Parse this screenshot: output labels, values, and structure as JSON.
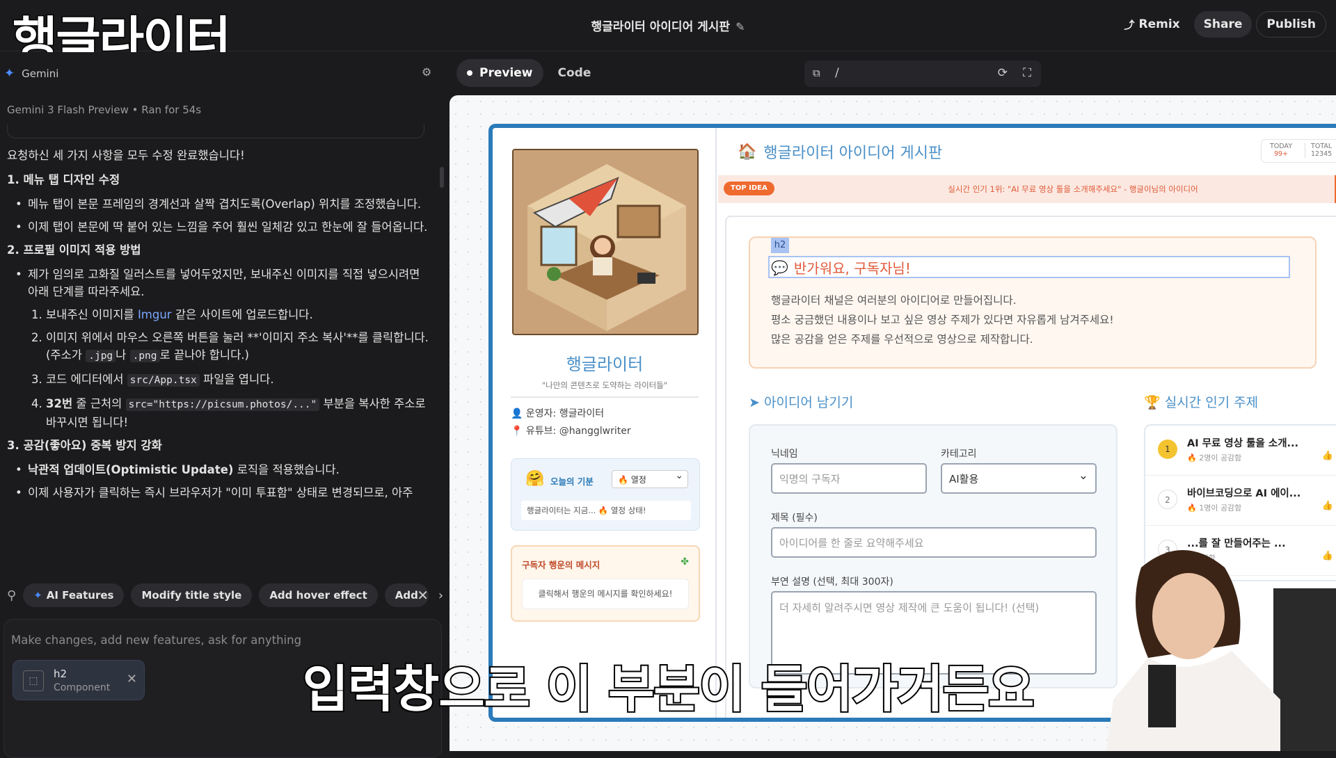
{
  "overlay": {
    "top_left_caption": "행글라이터",
    "subtitle": "입력창으로 이 부분이 들어가거든요"
  },
  "topbar": {
    "title": "행글라이터 아이디어 게시판",
    "remix": "Remix",
    "share": "Share",
    "publish": "Publish"
  },
  "chat": {
    "agent_name": "Gemini",
    "model_line": "Gemini 3 Flash Preview  •  Ran for 54s",
    "intro": "요청하신 세 가지 사항을 모두 수정 완료했습니다!",
    "s1_title": "1. 메뉴 탭 디자인 수정",
    "s1_b1": "메뉴 탭이 본문 프레임의 경계선과 살짝 겹치도록(Overlap) 위치를 조정했습니다.",
    "s1_b2": "이제 탭이 본문에 딱 붙어 있는 느낌을 주어 훨씬 일체감 있고 한눈에 잘 들어옵니다.",
    "s2_title": "2. 프로필 이미지 적용 방법",
    "s2_b1": "제가 임의로 고화질 일러스트를 넣어두었지만, 보내주신 이미지를 직접 넣으시려면 아래 단계를 따라주세요.",
    "s2_o1a": "보내주신 이미지를 ",
    "s2_o1_link": "Imgur",
    "s2_o1b": " 같은 사이트에 업로드합니다.",
    "s2_o2a": "이미지 위에서 마우스 오른쪽 버튼을 눌러 **'이미지 주소 복사'**를 클릭합니다. (주소가 ",
    "s2_o2_code1": ".jpg",
    "s2_o2b": "나 ",
    "s2_o2_code2": ".png",
    "s2_o2c": "로 끝나야 합니다.)",
    "s2_o3a": "코드 에디터에서 ",
    "s2_o3_code": "src/App.tsx",
    "s2_o3b": " 파일을 엽니다.",
    "s2_o4a": "32번",
    "s2_o4b": " 줄 근처의 ",
    "s2_o4_code": "src=\"https://picsum.photos/...\"",
    "s2_o4c": " 부분을 복사한 주소로 바꾸시면 됩니다!",
    "s3_title": "3. 공감(좋아요) 중복 방지 강화",
    "s3_b1a": "낙관적 업데이트(Optimistic Update)",
    "s3_b1b": " 로직을 적용했습니다.",
    "s3_b2": "이제 사용자가 클릭하는 즉시 브라우저가 \"이미 투표함\" 상태로 변경되므로, 아주"
  },
  "suggestions": [
    "AI Features",
    "Modify title style",
    "Add hover effect",
    "Add"
  ],
  "composer": {
    "placeholder": "Make changes, add new features, ask for anything",
    "chip_title": "h2",
    "chip_sub": "Component"
  },
  "viewer": {
    "tab_preview": "Preview",
    "tab_code": "Code",
    "url": "/"
  },
  "app": {
    "profile_name": "행글라이터",
    "tagline": "\"나만의 콘텐츠로 도약하는 라이터들\"",
    "operator": "운영자: 행글라이터",
    "youtube": "유튜브: @hangglwriter",
    "mood_label": "오늘의 기분",
    "mood_value": "열정",
    "mood_status": "행글라이터는 지금... 🔥 열정 상태!",
    "lucky_label": "구독자 행운의 메시지",
    "lucky_text": "클릭해서 행운의 메시지를 확인하세요!",
    "board_title": "행글라이터 아이디어 게시판",
    "today_label": "TODAY",
    "today_value": "99+",
    "total_label": "TOTAL",
    "total_value": "12345",
    "ticker_badge": "TOP IDEA",
    "ticker_text": "실시간 인기 1위: \"AI 무료 영상 툴을 소개해주세요\" - 행글이님의 아이디어",
    "h2_tag": "h2",
    "welcome_title": "반가워요, 구독자님!",
    "welcome_p1": "행글라이터 채널은 여러분의 아이디어로 만들어집니다.",
    "welcome_p2": "평소 궁금했던 내용이나 보고 싶은 영상 주제가 있다면 자유롭게 남겨주세요!",
    "welcome_p3": "많은 공감을 얻은 주제를 우선적으로 영상으로 제작합니다.",
    "form_heading": "아이디어 남기기",
    "popular_heading": "실시간 인기 주제",
    "nick_label": "닉네임",
    "nick_ph": "익명의 구독자",
    "cat_label": "카테고리",
    "cat_value": "AI활용",
    "title_label": "제목 (필수)",
    "title_ph": "아이디어를 한 줄로 요약해주세요",
    "desc_label": "부연 설명 (선택, 최대 300자)",
    "desc_ph": "더 자세히 알려주시면 영상 제작에 큰 도움이 됩니다! (선택)",
    "popular": [
      {
        "rank": "1",
        "title": "AI 무료 영상 툴을 소개...",
        "likes": "2명이 공감함"
      },
      {
        "rank": "2",
        "title": "바이브코딩으로 AI 에이...",
        "likes": "1명이 공감함"
      },
      {
        "rank": "3",
        "title": "...를 잘 만들어주는 ...",
        "likes": "...공감함"
      }
    ]
  },
  "colors": {
    "accent": "#4a90c8",
    "frame": "#2b7bb9",
    "hot": "#ef6a2f"
  }
}
